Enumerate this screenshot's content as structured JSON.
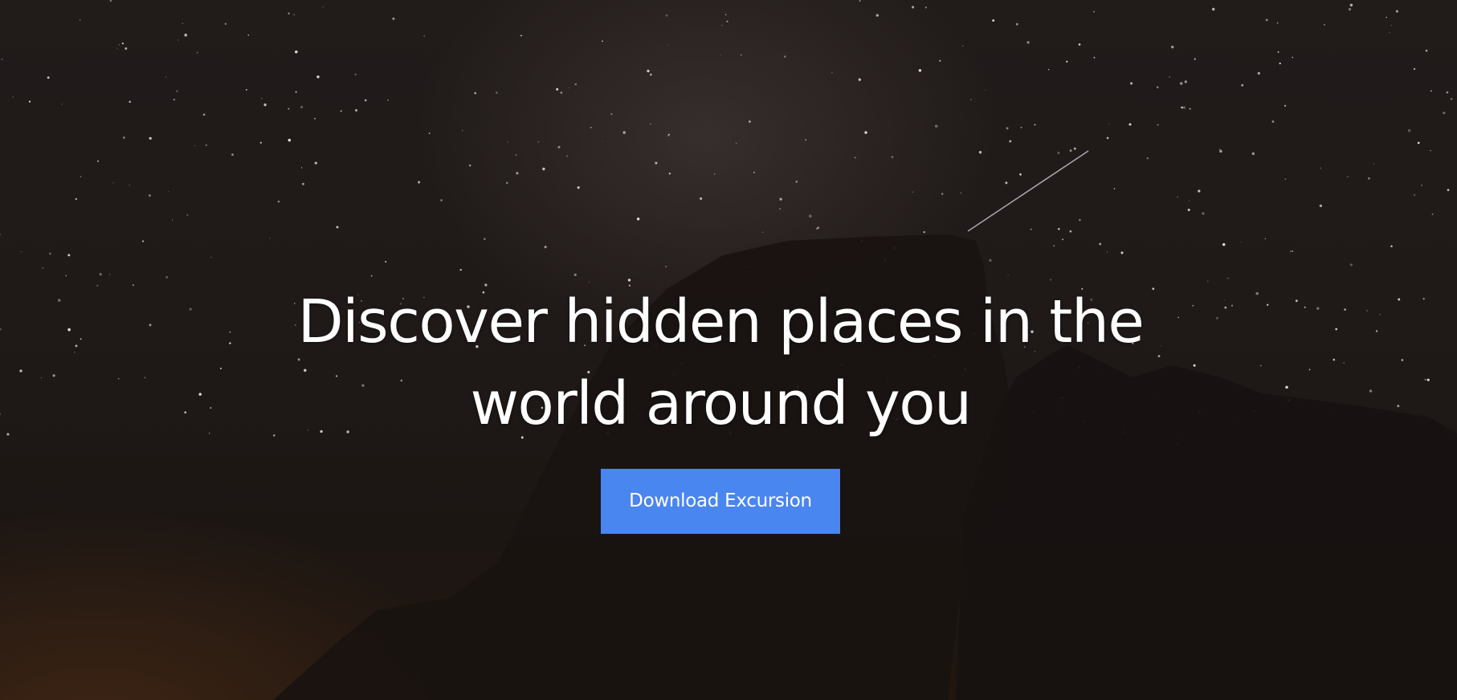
{
  "hero": {
    "title": "Discover hidden places in the world around you",
    "button_label": "Download Excursion"
  },
  "colors": {
    "button_bg": "#4a86f0",
    "title_text": "#ffffff",
    "background": "#1f1918"
  }
}
